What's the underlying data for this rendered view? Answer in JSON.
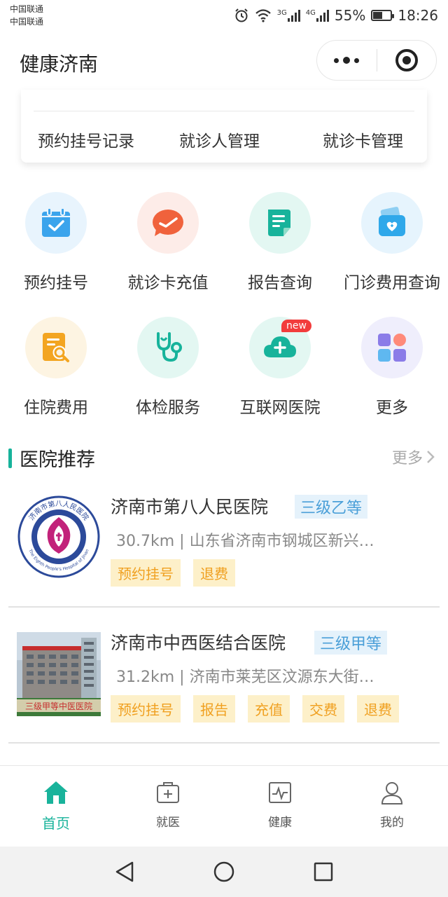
{
  "status_bar": {
    "carrier_1": "中国联通",
    "carrier_2": "中国联通",
    "net_1": "3G",
    "net_2": "4G",
    "battery": "55%",
    "battery_level": 0.55,
    "time": "18:26"
  },
  "title_bar": {
    "title": "健康济南",
    "more_icon": "more-dots-icon",
    "close_icon": "target-icon"
  },
  "card": {
    "links": [
      {
        "label": "预约挂号记录"
      },
      {
        "label": "就诊人管理"
      },
      {
        "label": "就诊卡管理"
      }
    ]
  },
  "functions": [
    {
      "label": "预约挂号",
      "icon": "calendar-check-icon",
      "bg": "#e8f4fd",
      "color": "#3ba4ec"
    },
    {
      "label": "就诊卡充值",
      "icon": "wallet-check-icon",
      "bg": "#fdece8",
      "color": "#f0623c"
    },
    {
      "label": "报告查询",
      "icon": "report-icon",
      "bg": "#e3f7f2",
      "color": "#17b39b"
    },
    {
      "label": "门诊费用查询",
      "icon": "medical-fee-icon",
      "bg": "#e6f4fd",
      "color": "#2fa8ea"
    },
    {
      "label": "住院费用",
      "icon": "document-search-icon",
      "bg": "#fdf4e2",
      "color": "#f3a521"
    },
    {
      "label": "体检服务",
      "icon": "stethoscope-icon",
      "bg": "#e3f7f2",
      "color": "#17b39b"
    },
    {
      "label": "互联网医院",
      "icon": "cloud-plus-icon",
      "bg": "#e3f7f2",
      "color": "#17b39b",
      "badge": "new"
    },
    {
      "label": "更多",
      "icon": "grid-apps-icon",
      "bg": "#efeefc",
      "color": "#8b7ce8"
    }
  ],
  "section": {
    "title": "医院推荐",
    "more": "更多"
  },
  "hospitals": [
    {
      "name": "济南市第八人民医院",
      "level": "三级乙等",
      "distance": "30.7km",
      "address": "山东省济南市钢城区新兴…",
      "tags": [
        "预约挂号",
        "退费"
      ],
      "logo_text": "济南市第八人民医院",
      "logo_year": "1956",
      "logo_en": "The Eighth People's Hospital of Jinan"
    },
    {
      "name": "济南市中西医结合医院",
      "level": "三级甲等",
      "distance": "31.2km",
      "address": "济南市莱芜区汶源东大街…",
      "tags": [
        "预约挂号",
        "报告",
        "充值",
        "交费",
        "退费"
      ],
      "photo_caption": "三级甲等中医医院"
    }
  ],
  "tabbar": {
    "tabs": [
      {
        "label": "首页",
        "icon": "home-icon"
      },
      {
        "label": "就医",
        "icon": "medical-kit-icon"
      },
      {
        "label": "健康",
        "icon": "health-chart-icon"
      },
      {
        "label": "我的",
        "icon": "user-icon"
      }
    ]
  },
  "colors": {
    "accent": "#17b39b",
    "tag_text": "#f0a020",
    "tag_bg": "#fdf0c9",
    "level_text": "#4a9fd8",
    "level_bg": "#e5f2fb"
  }
}
